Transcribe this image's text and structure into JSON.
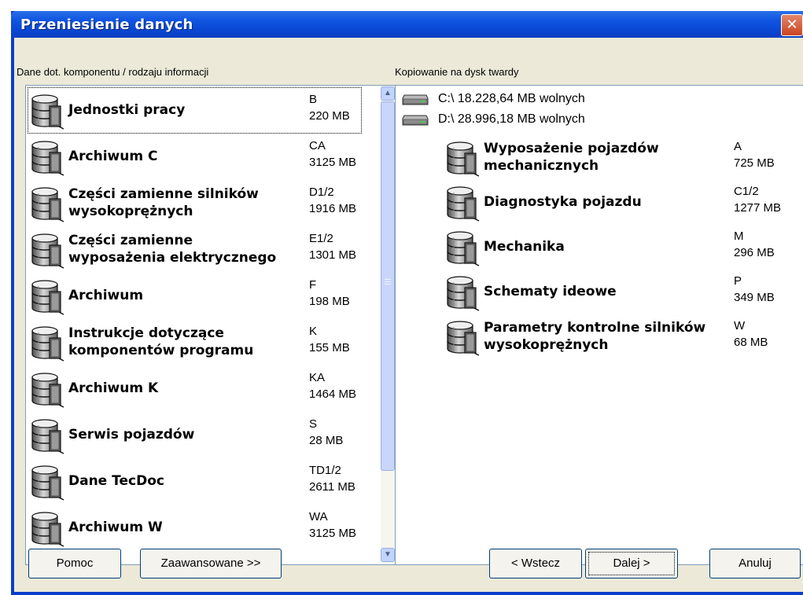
{
  "window": {
    "title": "Przeniesienie danych",
    "close_glyph": "✕"
  },
  "left_panel": {
    "label": "Dane dot. komponentu / rodzaju informacji",
    "items": [
      {
        "name_line1": "Jednostki pracy",
        "name_line2": "",
        "code": "B",
        "size": "220 MB",
        "selected": true
      },
      {
        "name_line1": "Archiwum C",
        "name_line2": "",
        "code": "CA",
        "size": "3125 MB"
      },
      {
        "name_line1": "Części zamienne silników",
        "name_line2": "wysokoprężnych",
        "code": "D1/2",
        "size": "1916 MB"
      },
      {
        "name_line1": "Części zamienne",
        "name_line2": "wyposażenia elektrycznego",
        "code": "E1/2",
        "size": "1301 MB"
      },
      {
        "name_line1": "Archiwum",
        "name_line2": "",
        "code": "F",
        "size": "198 MB"
      },
      {
        "name_line1": "Instrukcje dotyczące",
        "name_line2": "komponentów programu",
        "code": "K",
        "size": "155 MB"
      },
      {
        "name_line1": "Archiwum K",
        "name_line2": "",
        "code": "KA",
        "size": "1464 MB"
      },
      {
        "name_line1": "Serwis pojazdów",
        "name_line2": "",
        "code": "S",
        "size": "28 MB"
      },
      {
        "name_line1": "Dane TecDoc",
        "name_line2": "",
        "code": "TD1/2",
        "size": "2611 MB"
      },
      {
        "name_line1": "Archiwum W",
        "name_line2": "",
        "code": "WA",
        "size": "3125 MB"
      }
    ],
    "scroll_up_glyph": "▲",
    "scroll_down_glyph": "▼"
  },
  "right_panel": {
    "label": "Kopiowanie na dysk twardy",
    "drives": [
      {
        "text": "C:\\ 18.228,64 MB wolnych"
      },
      {
        "text": "D:\\ 28.996,18 MB wolnych"
      }
    ],
    "items": [
      {
        "name_line1": "Wyposażenie pojazdów",
        "name_line2": "mechanicznych",
        "code": "A",
        "size": "725 MB"
      },
      {
        "name_line1": "Diagnostyka pojazdu",
        "name_line2": "",
        "code": "C1/2",
        "size": "1277 MB"
      },
      {
        "name_line1": "Mechanika",
        "name_line2": "",
        "code": "M",
        "size": "296 MB"
      },
      {
        "name_line1": "Schematy ideowe",
        "name_line2": "",
        "code": "P",
        "size": "349 MB"
      },
      {
        "name_line1": "Parametry kontrolne silników",
        "name_line2": "wysokoprężnych",
        "code": "W",
        "size": "68 MB"
      }
    ]
  },
  "buttons": {
    "help": "Pomoc",
    "advanced": "Zaawansowane >>",
    "back": "< Wstecz",
    "next": "Dalej >",
    "cancel": "Anuluj"
  },
  "colors": {
    "titlebar": "#0a47d3",
    "dialog_bg": "#ece9d8",
    "close_button": "#c94523",
    "panel_border": "#7f9db9"
  }
}
